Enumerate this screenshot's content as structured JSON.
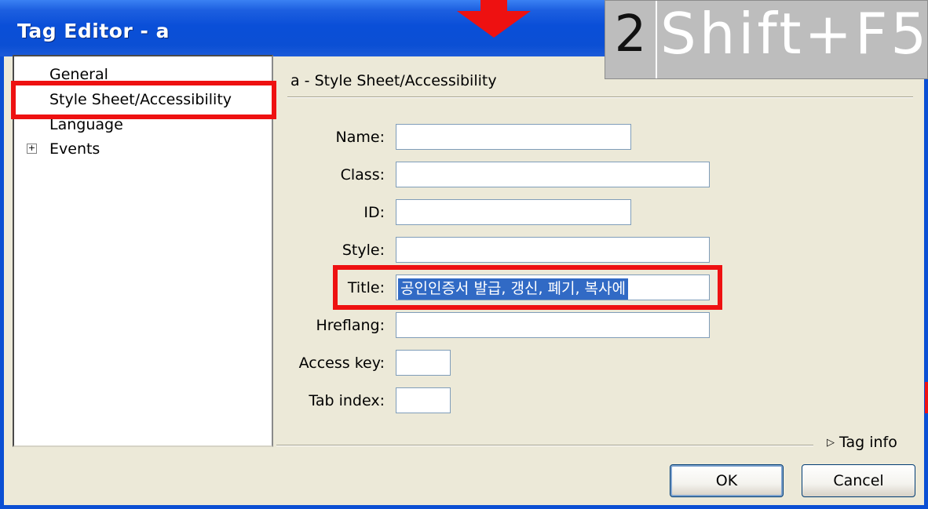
{
  "window": {
    "title": "Tag Editor - a"
  },
  "overlay": {
    "step_number": "2",
    "shortcut": "Shift+F5",
    "highlight_color": "#ee1111"
  },
  "tree": {
    "items": [
      {
        "label": "General"
      },
      {
        "label": "Style Sheet/Accessibility",
        "selected": true
      },
      {
        "label": "Language"
      },
      {
        "label": "Events",
        "expandable": true,
        "expander": "+"
      }
    ]
  },
  "panel": {
    "header": "a - Style Sheet/Accessibility"
  },
  "form": {
    "name": {
      "label": "Name:",
      "value": ""
    },
    "class": {
      "label": "Class:",
      "value": ""
    },
    "id": {
      "label": "ID:",
      "value": ""
    },
    "style": {
      "label": "Style:",
      "value": ""
    },
    "title": {
      "label": "Title:",
      "value": "공인인증서 발급, 갱신, 폐기, 복사에"
    },
    "hreflang": {
      "label": "Hreflang:",
      "value": ""
    },
    "access_key": {
      "label": "Access key:",
      "value": ""
    },
    "tab_index": {
      "label": "Tab index:",
      "value": ""
    }
  },
  "tag_info": {
    "label": "Tag info",
    "icon": "triangle-right-icon"
  },
  "buttons": {
    "ok": "OK",
    "cancel": "Cancel"
  }
}
